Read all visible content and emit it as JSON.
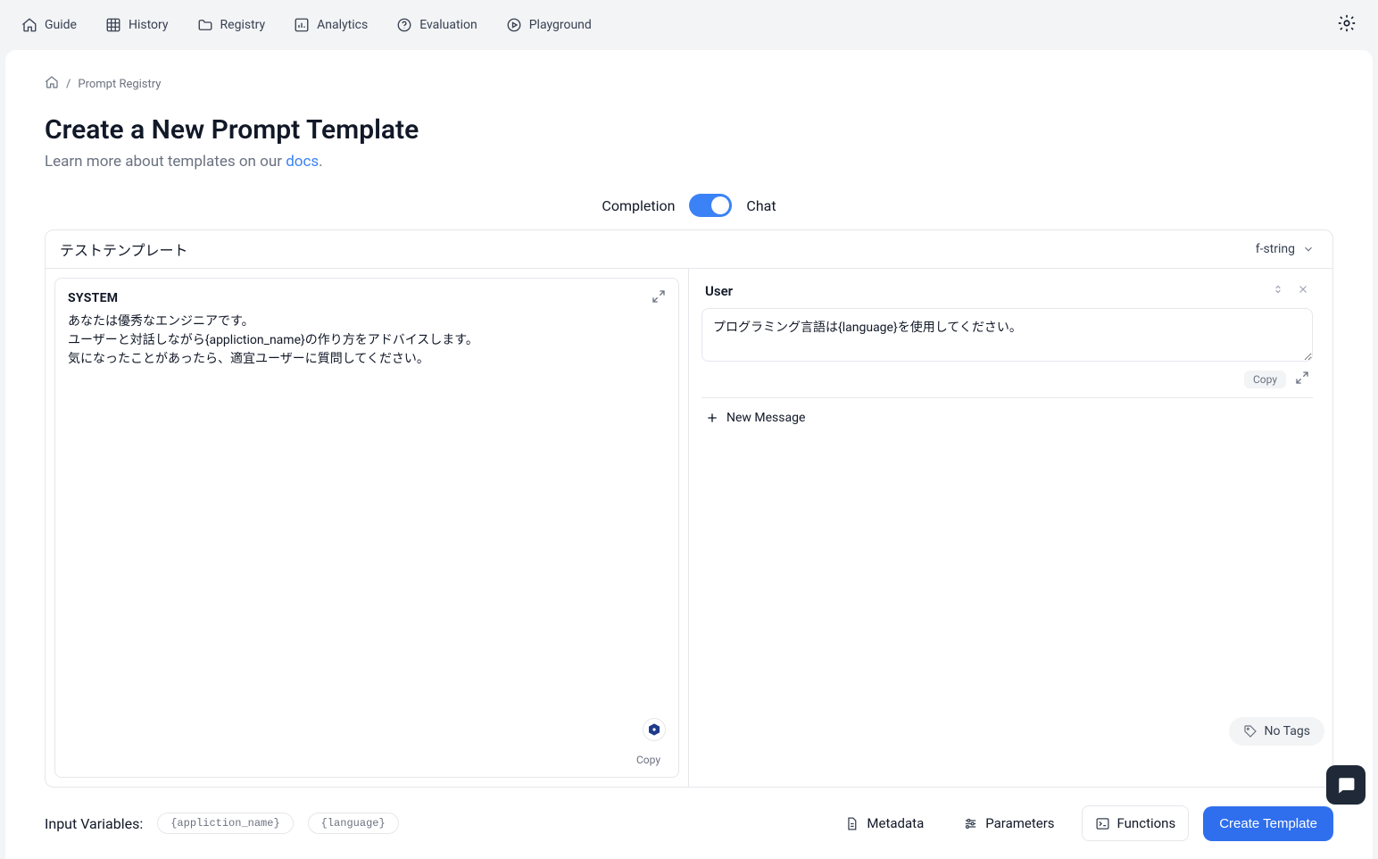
{
  "nav": {
    "items": [
      {
        "label": "Guide"
      },
      {
        "label": "History"
      },
      {
        "label": "Registry"
      },
      {
        "label": "Analytics"
      },
      {
        "label": "Evaluation"
      },
      {
        "label": "Playground"
      }
    ]
  },
  "breadcrumb": {
    "current": "Prompt Registry",
    "separator": "/"
  },
  "header": {
    "title": "Create a New Prompt Template",
    "subtitle_prefix": "Learn more about templates on our ",
    "docs_link_text": "docs",
    "subtitle_suffix": "."
  },
  "mode": {
    "left_label": "Completion",
    "right_label": "Chat",
    "state": "chat"
  },
  "template": {
    "name": "テストテンプレート",
    "format": "f-string"
  },
  "system": {
    "label": "SYSTEM",
    "content": "あなたは優秀なエンジニアです。\nユーザーと対話しながら{appliction_name}の作り方をアドバイスします。\n気になったことがあったら、適宜ユーザーに質問してください。",
    "copy_label": "Copy"
  },
  "messages": [
    {
      "role": "User",
      "content": "プログラミング言語は{language}を使用してください。"
    }
  ],
  "message_actions": {
    "copy_label": "Copy",
    "new_message_label": "New Message"
  },
  "tags": {
    "label": "No Tags"
  },
  "input_vars": {
    "label": "Input Variables:",
    "vars": [
      "{appliction_name}",
      "{language}"
    ]
  },
  "bottom": {
    "metadata": "Metadata",
    "parameters": "Parameters",
    "functions": "Functions",
    "create": "Create Template"
  }
}
